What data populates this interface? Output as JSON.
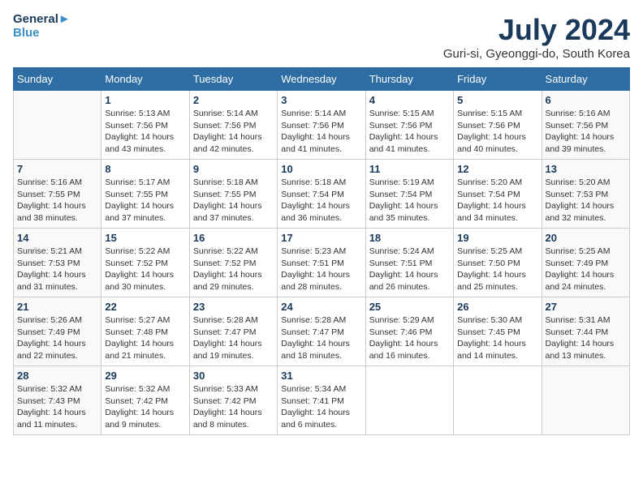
{
  "header": {
    "logo_line1": "General",
    "logo_line2": "Blue",
    "month_title": "July 2024",
    "location": "Guri-si, Gyeonggi-do, South Korea"
  },
  "days_of_week": [
    "Sunday",
    "Monday",
    "Tuesday",
    "Wednesday",
    "Thursday",
    "Friday",
    "Saturday"
  ],
  "weeks": [
    [
      {
        "day": "",
        "sunrise": "",
        "sunset": "",
        "daylight": ""
      },
      {
        "day": "1",
        "sunrise": "Sunrise: 5:13 AM",
        "sunset": "Sunset: 7:56 PM",
        "daylight": "Daylight: 14 hours and 43 minutes."
      },
      {
        "day": "2",
        "sunrise": "Sunrise: 5:14 AM",
        "sunset": "Sunset: 7:56 PM",
        "daylight": "Daylight: 14 hours and 42 minutes."
      },
      {
        "day": "3",
        "sunrise": "Sunrise: 5:14 AM",
        "sunset": "Sunset: 7:56 PM",
        "daylight": "Daylight: 14 hours and 41 minutes."
      },
      {
        "day": "4",
        "sunrise": "Sunrise: 5:15 AM",
        "sunset": "Sunset: 7:56 PM",
        "daylight": "Daylight: 14 hours and 41 minutes."
      },
      {
        "day": "5",
        "sunrise": "Sunrise: 5:15 AM",
        "sunset": "Sunset: 7:56 PM",
        "daylight": "Daylight: 14 hours and 40 minutes."
      },
      {
        "day": "6",
        "sunrise": "Sunrise: 5:16 AM",
        "sunset": "Sunset: 7:56 PM",
        "daylight": "Daylight: 14 hours and 39 minutes."
      }
    ],
    [
      {
        "day": "7",
        "sunrise": "Sunrise: 5:16 AM",
        "sunset": "Sunset: 7:55 PM",
        "daylight": "Daylight: 14 hours and 38 minutes."
      },
      {
        "day": "8",
        "sunrise": "Sunrise: 5:17 AM",
        "sunset": "Sunset: 7:55 PM",
        "daylight": "Daylight: 14 hours and 37 minutes."
      },
      {
        "day": "9",
        "sunrise": "Sunrise: 5:18 AM",
        "sunset": "Sunset: 7:55 PM",
        "daylight": "Daylight: 14 hours and 37 minutes."
      },
      {
        "day": "10",
        "sunrise": "Sunrise: 5:18 AM",
        "sunset": "Sunset: 7:54 PM",
        "daylight": "Daylight: 14 hours and 36 minutes."
      },
      {
        "day": "11",
        "sunrise": "Sunrise: 5:19 AM",
        "sunset": "Sunset: 7:54 PM",
        "daylight": "Daylight: 14 hours and 35 minutes."
      },
      {
        "day": "12",
        "sunrise": "Sunrise: 5:20 AM",
        "sunset": "Sunset: 7:54 PM",
        "daylight": "Daylight: 14 hours and 34 minutes."
      },
      {
        "day": "13",
        "sunrise": "Sunrise: 5:20 AM",
        "sunset": "Sunset: 7:53 PM",
        "daylight": "Daylight: 14 hours and 32 minutes."
      }
    ],
    [
      {
        "day": "14",
        "sunrise": "Sunrise: 5:21 AM",
        "sunset": "Sunset: 7:53 PM",
        "daylight": "Daylight: 14 hours and 31 minutes."
      },
      {
        "day": "15",
        "sunrise": "Sunrise: 5:22 AM",
        "sunset": "Sunset: 7:52 PM",
        "daylight": "Daylight: 14 hours and 30 minutes."
      },
      {
        "day": "16",
        "sunrise": "Sunrise: 5:22 AM",
        "sunset": "Sunset: 7:52 PM",
        "daylight": "Daylight: 14 hours and 29 minutes."
      },
      {
        "day": "17",
        "sunrise": "Sunrise: 5:23 AM",
        "sunset": "Sunset: 7:51 PM",
        "daylight": "Daylight: 14 hours and 28 minutes."
      },
      {
        "day": "18",
        "sunrise": "Sunrise: 5:24 AM",
        "sunset": "Sunset: 7:51 PM",
        "daylight": "Daylight: 14 hours and 26 minutes."
      },
      {
        "day": "19",
        "sunrise": "Sunrise: 5:25 AM",
        "sunset": "Sunset: 7:50 PM",
        "daylight": "Daylight: 14 hours and 25 minutes."
      },
      {
        "day": "20",
        "sunrise": "Sunrise: 5:25 AM",
        "sunset": "Sunset: 7:49 PM",
        "daylight": "Daylight: 14 hours and 24 minutes."
      }
    ],
    [
      {
        "day": "21",
        "sunrise": "Sunrise: 5:26 AM",
        "sunset": "Sunset: 7:49 PM",
        "daylight": "Daylight: 14 hours and 22 minutes."
      },
      {
        "day": "22",
        "sunrise": "Sunrise: 5:27 AM",
        "sunset": "Sunset: 7:48 PM",
        "daylight": "Daylight: 14 hours and 21 minutes."
      },
      {
        "day": "23",
        "sunrise": "Sunrise: 5:28 AM",
        "sunset": "Sunset: 7:47 PM",
        "daylight": "Daylight: 14 hours and 19 minutes."
      },
      {
        "day": "24",
        "sunrise": "Sunrise: 5:28 AM",
        "sunset": "Sunset: 7:47 PM",
        "daylight": "Daylight: 14 hours and 18 minutes."
      },
      {
        "day": "25",
        "sunrise": "Sunrise: 5:29 AM",
        "sunset": "Sunset: 7:46 PM",
        "daylight": "Daylight: 14 hours and 16 minutes."
      },
      {
        "day": "26",
        "sunrise": "Sunrise: 5:30 AM",
        "sunset": "Sunset: 7:45 PM",
        "daylight": "Daylight: 14 hours and 14 minutes."
      },
      {
        "day": "27",
        "sunrise": "Sunrise: 5:31 AM",
        "sunset": "Sunset: 7:44 PM",
        "daylight": "Daylight: 14 hours and 13 minutes."
      }
    ],
    [
      {
        "day": "28",
        "sunrise": "Sunrise: 5:32 AM",
        "sunset": "Sunset: 7:43 PM",
        "daylight": "Daylight: 14 hours and 11 minutes."
      },
      {
        "day": "29",
        "sunrise": "Sunrise: 5:32 AM",
        "sunset": "Sunset: 7:42 PM",
        "daylight": "Daylight: 14 hours and 9 minutes."
      },
      {
        "day": "30",
        "sunrise": "Sunrise: 5:33 AM",
        "sunset": "Sunset: 7:42 PM",
        "daylight": "Daylight: 14 hours and 8 minutes."
      },
      {
        "day": "31",
        "sunrise": "Sunrise: 5:34 AM",
        "sunset": "Sunset: 7:41 PM",
        "daylight": "Daylight: 14 hours and 6 minutes."
      },
      {
        "day": "",
        "sunrise": "",
        "sunset": "",
        "daylight": ""
      },
      {
        "day": "",
        "sunrise": "",
        "sunset": "",
        "daylight": ""
      },
      {
        "day": "",
        "sunrise": "",
        "sunset": "",
        "daylight": ""
      }
    ]
  ]
}
